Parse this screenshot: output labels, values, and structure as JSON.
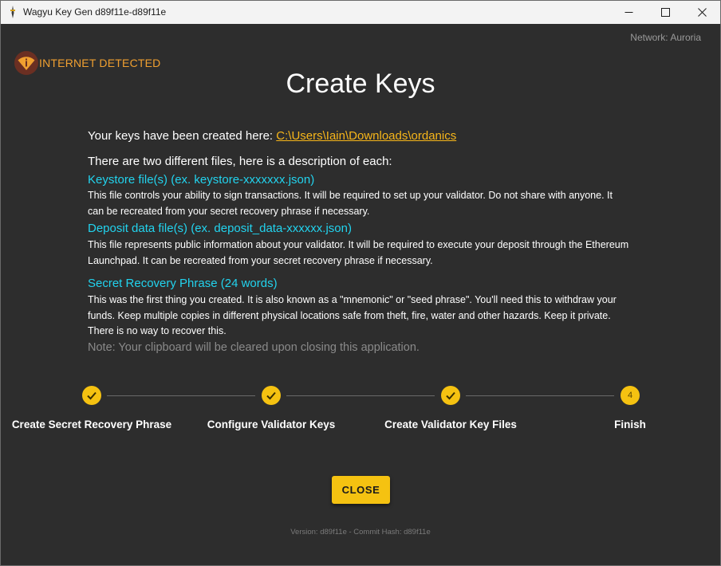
{
  "window": {
    "title": "Wagyu Key Gen d89f11e-d89f11e",
    "controls": {
      "minimize": "minimize-icon",
      "maximize": "maximize-icon",
      "close": "close-icon"
    }
  },
  "header": {
    "network": "Network: Auroria",
    "internet_warning": "INTERNET DETECTED",
    "page_title": "Create Keys"
  },
  "main": {
    "created_prefix": "Your keys have been created here: ",
    "created_path": "C:\\Users\\Iain\\Downloads\\ordanics",
    "files_intro": "There are two different files, here is a description of each:",
    "keystore_heading": "Keystore file(s) (ex. keystore-xxxxxxx.json)",
    "keystore_desc": "This file controls your ability to sign transactions. It will be required to set up your validator. Do not share with anyone. It can be recreated from your secret recovery phrase if necessary.",
    "deposit_heading": "Deposit data file(s) (ex. deposit_data-xxxxxx.json)",
    "deposit_desc": "This file represents public information about your validator. It will be required to execute your deposit through the Ethereum Launchpad. It can be recreated from your secret recovery phrase if necessary.",
    "srp_heading": "Secret Recovery Phrase (24 words)",
    "srp_desc": "This was the first thing you created. It is also known as a \"mnemonic\" or \"seed phrase\". You'll need this to withdraw your funds. Keep multiple copies in different physical locations safe from theft, fire, water and other hazards. Keep it private. There is no way to recover this.",
    "note": "Note: Your clipboard will be cleared upon closing this application."
  },
  "stepper": {
    "steps": [
      {
        "label": "Create Secret Recovery Phrase",
        "state": "completed",
        "icon": "check-icon"
      },
      {
        "label": "Configure Validator Keys",
        "state": "completed",
        "icon": "check-icon"
      },
      {
        "label": "Create Validator Key Files",
        "state": "completed",
        "icon": "check-icon"
      },
      {
        "label": "Finish",
        "state": "active",
        "number": "4"
      }
    ]
  },
  "actions": {
    "close_label": "CLOSE"
  },
  "footer": {
    "version": "Version: d89f11e - Commit Hash: d89f11e"
  },
  "colors": {
    "accent": "#f5c211",
    "link": "#f7b61a",
    "heading_cyan": "#22d3ee",
    "warning": "#f0a030",
    "background": "#2d2d2d"
  }
}
